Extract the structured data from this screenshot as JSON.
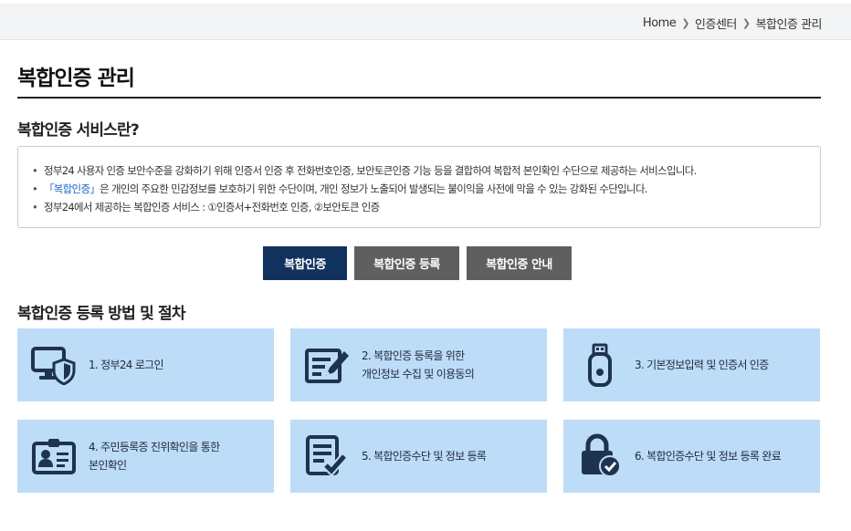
{
  "breadcrumb": {
    "items": [
      "Home",
      "인증센터",
      "복합인증 관리"
    ]
  },
  "page_title": "복합인증 관리",
  "intro": {
    "title": "복합인증 서비스란?",
    "line1": "정부24 사용자 인증 보안수준을 강화하기 위해 인증서 인증 후 전화번호인증, 보안토큰인증 기능 등을 결합하여 복합적 본인확인 수단으로 제공하는 서비스입니다.",
    "line2_highlight": "「복합인증」",
    "line2_rest": "은 개인의 주요한 민감정보를 보호하기 위한 수단이며, 개인 정보가 노출되어 발생되는 불이익을 사전에 막을 수 있는 강화된 수단입니다.",
    "line3": "정부24에서 제공하는 복합인증 서비스 : ①인증서+전화번호 인증, ②보안토큰 인증"
  },
  "tabs": [
    "복합인증",
    "복합인증 등록",
    "복합인증 안내"
  ],
  "steps_title": "복합인증 등록 방법 및 절차",
  "steps": [
    {
      "line1": "1. 정부24 로그인",
      "line2": "",
      "icon": "monitor-shield-icon"
    },
    {
      "line1": "2. 복합인증 등록을 위한",
      "line2": "개인정보 수집 및 이용동의",
      "icon": "document-pen-icon"
    },
    {
      "line1": "3. 기본정보입력 및 인증서 인증",
      "line2": "",
      "icon": "usb-token-icon"
    },
    {
      "line1": "4. 주민등록증 진위확인을 통한",
      "line2": "본인확인",
      "icon": "id-card-icon"
    },
    {
      "line1": "5. 복합인증수단 및 정보 등록",
      "line2": "",
      "icon": "checklist-icon"
    },
    {
      "line1": "6. 복합인증수단 및 정보 등록 완료",
      "line2": "",
      "icon": "lock-check-icon"
    }
  ],
  "colors": {
    "navy": "#12325e",
    "gray_tab": "#5f5f5f",
    "card_bg": "#bcdcf8",
    "icon": "#1d3350",
    "highlight": "#1e64c8"
  }
}
